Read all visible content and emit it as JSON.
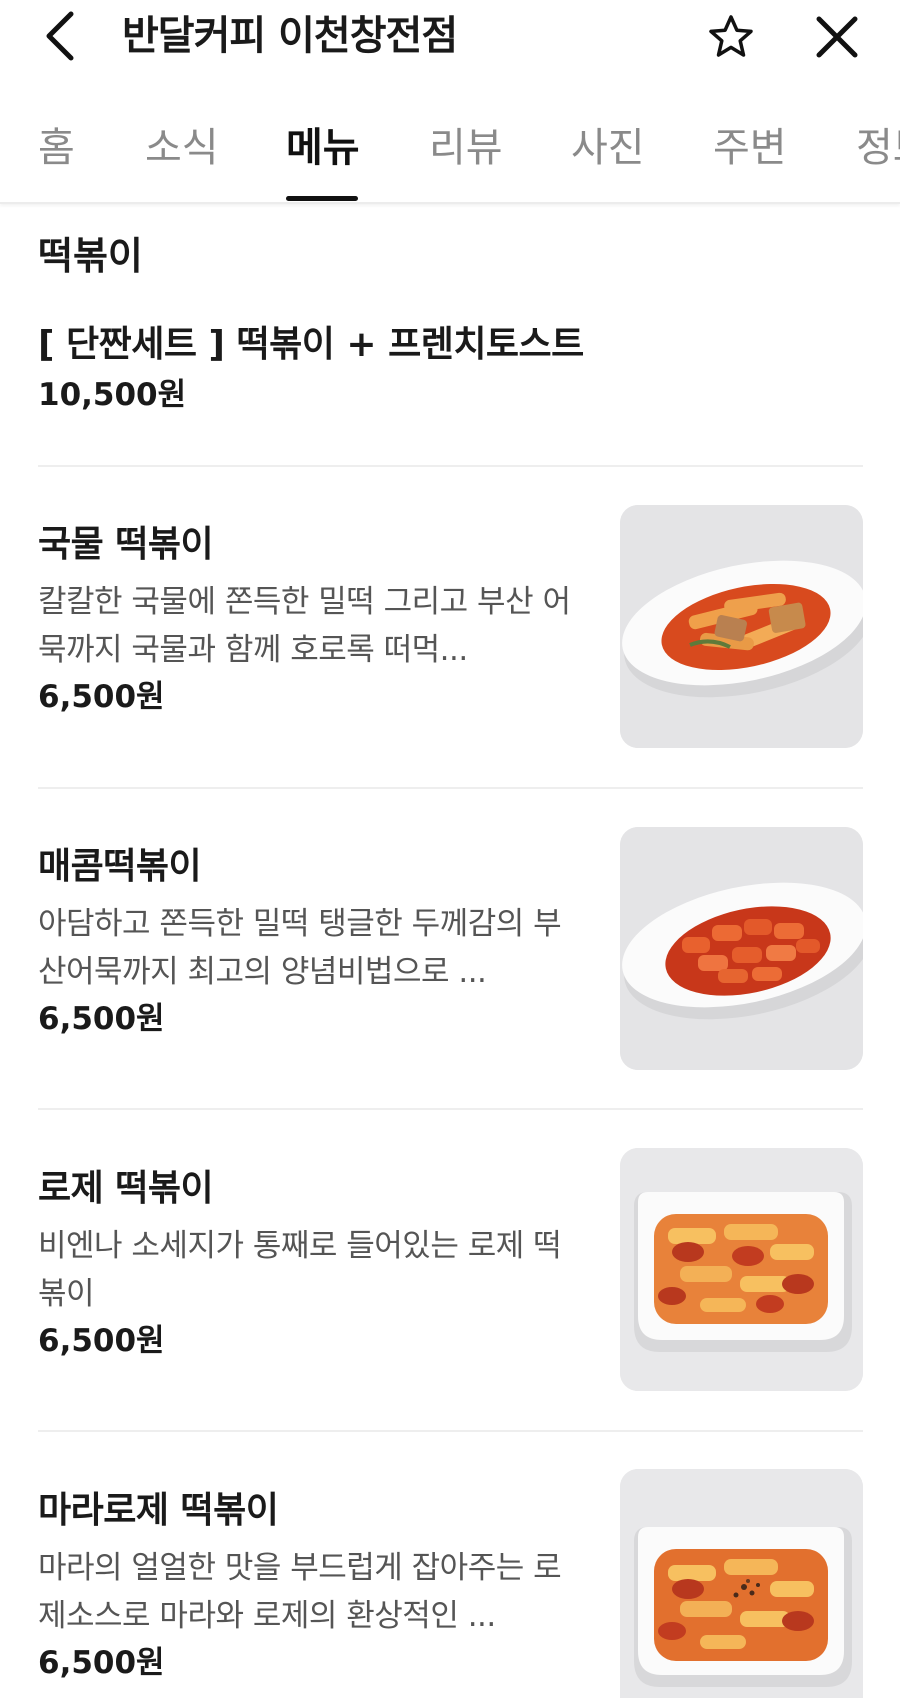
{
  "header": {
    "title": "반달커피 이천창전점",
    "back_icon": "chevron-left-icon",
    "favorite_icon": "star-icon",
    "close_icon": "close-icon"
  },
  "tabs": [
    {
      "label": "홈"
    },
    {
      "label": "소식"
    },
    {
      "label": "메뉴",
      "active": true
    },
    {
      "label": "리뷰"
    },
    {
      "label": "사진"
    },
    {
      "label": "주변"
    },
    {
      "label": "정보"
    }
  ],
  "menu": {
    "section_title": "떡볶이",
    "items": [
      {
        "name": "[ 단짠세트 ] 떡볶이 + 프렌치토스트",
        "description": "",
        "price": "10,500원"
      },
      {
        "name": "국물 떡볶이",
        "description": "칼칼한 국물에 쫀득한 밀떡 그리고 부산 어묵까지 국물과 함께 호로록 떠먹...",
        "price": "6,500원",
        "image": "oval-plate"
      },
      {
        "name": "매콤떡볶이",
        "description": "아담하고 쫀득한 밀떡 탱글한 두께감의 부산어묵까지 최고의 양념비법으로 ...",
        "price": "6,500원",
        "image": "oval-plate"
      },
      {
        "name": "로제 떡볶이",
        "description": "비엔나 소세지가 통째로 들어있는 로제 떡볶이",
        "price": "6,500원",
        "image": "square-bowl"
      },
      {
        "name": "마라로제 떡볶이",
        "description": "마라의 얼얼한 맛을 부드럽게 잡아주는 로제소스로 마라와 로제의 환상적인 ...",
        "price": "6,500원",
        "image": "square-bowl"
      }
    ]
  },
  "colors": {
    "text_primary": "#1a1a1a",
    "text_secondary": "#555555",
    "tab_inactive": "#8a8a8a",
    "divider": "#eeeeee",
    "sauce_red": "#d84a1e",
    "sauce_rose": "#e8823a"
  }
}
